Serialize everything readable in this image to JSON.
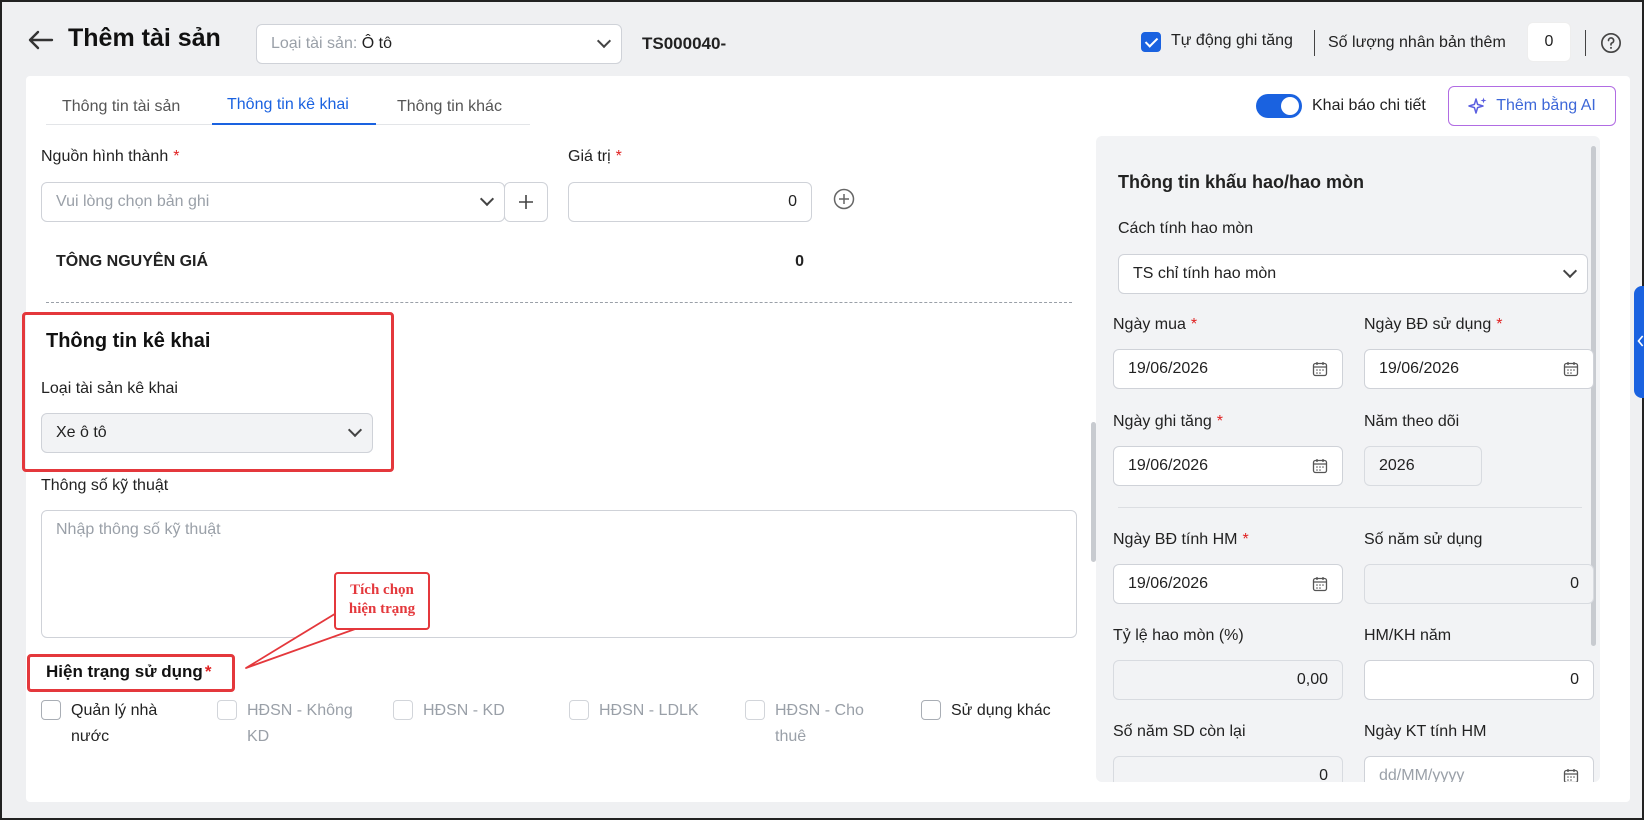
{
  "header": {
    "title": "Thêm tài sản",
    "asset_type_prefix": "Loại tài sản: ",
    "asset_type_value": "Ô tô",
    "asset_code": "TS000040-",
    "auto_increase_label": "Tự động ghi tăng",
    "auto_increase_checked": true,
    "duplicate_label": "Số lượng nhân bản thêm",
    "duplicate_value": "0"
  },
  "tabs": [
    "Thông tin tài sản",
    "Thông tin kê khai",
    "Thông tin khác"
  ],
  "active_tab": "Thông tin kê khai",
  "toolbar": {
    "detail_toggle_label": "Khai báo chi tiết",
    "detail_toggle_on": true,
    "ai_button_label": "Thêm bằng AI"
  },
  "source": {
    "label": "Nguồn hình thành",
    "placeholder": "Vui lòng chọn bản ghi",
    "value_label": "Giá trị",
    "value": "0"
  },
  "total": {
    "label": "TÔNG NGUYÊN GIÁ",
    "value": "0"
  },
  "declaration": {
    "section_title": "Thông tin kê khai",
    "type_label": "Loại tài sản kê khai",
    "type_value": "Xe ô tô"
  },
  "specs": {
    "label": "Thông số kỹ thuật",
    "placeholder": "Nhập thông số kỹ thuật"
  },
  "callout": {
    "line1": "Tích chọn",
    "line2": "hiện trạng"
  },
  "usage": {
    "title": "Hiện trạng sử dụng",
    "options": [
      {
        "line1": "Quản lý nhà",
        "line2": "nước",
        "enabled": true
      },
      {
        "line1": "HĐSN - Không",
        "line2": "KD",
        "enabled": false
      },
      {
        "line1": "HĐSN - KD",
        "line2": "",
        "enabled": false
      },
      {
        "line1": "HĐSN - LDLK",
        "line2": "",
        "enabled": false
      },
      {
        "line1": "HĐSN - Cho",
        "line2": "thuê",
        "enabled": false
      },
      {
        "line1": "Sử dụng khác",
        "line2": "",
        "enabled": true
      }
    ]
  },
  "depreciation": {
    "title": "Thông tin khấu hao/hao mòn",
    "method_label": "Cách tính hao mòn",
    "method_value": "TS chỉ tính hao mòn",
    "purchase_date_label": "Ngày mua",
    "purchase_date": "19/06/2026",
    "use_start_label": "Ngày BĐ sử dụng",
    "use_start": "19/06/2026",
    "increase_date_label": "Ngày ghi tăng",
    "increase_date": "19/06/2026",
    "tracking_year_label": "Năm theo dõi",
    "tracking_year": "2026",
    "dep_start_label": "Ngày BĐ tính HM",
    "dep_start": "19/06/2026",
    "years_use_label": "Số năm sử dụng",
    "years_use": "0",
    "rate_label": "Tỷ lệ hao mòn (%)",
    "rate": "0,00",
    "annual_label": "HM/KH năm",
    "annual": "0",
    "remaining_label": "Số năm SD còn lại",
    "remaining": "0",
    "end_date_label": "Ngày KT tính HM",
    "end_date_placeholder": "dd/MM/yyyy"
  },
  "colors": {
    "accent": "#1a62e0",
    "annotation": "#e4383c",
    "required": "#e02020"
  }
}
